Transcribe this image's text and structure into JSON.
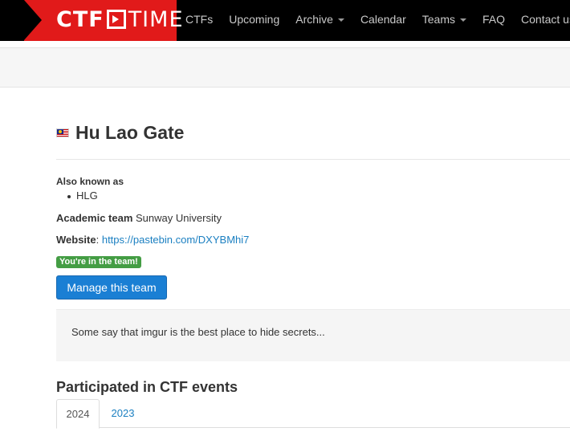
{
  "navbar": {
    "brand": {
      "part1": "CTF",
      "part2": "TIME"
    },
    "items": [
      {
        "label": "CTFs",
        "dropdown": false
      },
      {
        "label": "Upcoming",
        "dropdown": false
      },
      {
        "label": "Archive",
        "dropdown": true
      },
      {
        "label": "Calendar",
        "dropdown": false
      },
      {
        "label": "Teams",
        "dropdown": true
      },
      {
        "label": "FAQ",
        "dropdown": false
      },
      {
        "label": "Contact us",
        "dropdown": true
      }
    ]
  },
  "team": {
    "flag_icon": "malaysia-flag-icon",
    "name": "Hu Lao Gate",
    "aka_label": "Also known as",
    "aka": [
      "HLG"
    ],
    "academic_label": "Academic team",
    "academic_value": "Sunway University",
    "website_label": "Website",
    "website_sep": ": ",
    "website_url": "https://pastebin.com/DXYBMhi7",
    "membership_badge": "You're in the team!",
    "manage_button": "Manage this team",
    "description": "Some say that imgur is the best place to hide secrets..."
  },
  "events": {
    "title": "Participated in CTF events",
    "tabs": [
      {
        "label": "2024",
        "active": true
      },
      {
        "label": "2023",
        "active": false
      }
    ]
  },
  "colors": {
    "brand_red": "#e11a1a",
    "navbar_bg": "#000000",
    "link": "#1a7fc1",
    "primary_button": "#1a7fd4",
    "success_badge": "#449d44"
  }
}
